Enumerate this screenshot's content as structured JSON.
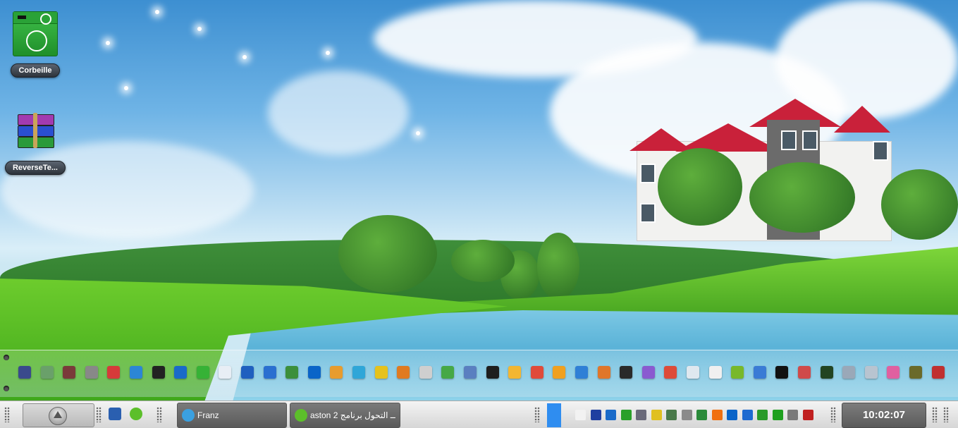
{
  "desktop": {
    "icons": [
      {
        "label": "Corbeille",
        "icon": "recycle-bin-icon"
      },
      {
        "label": "ReverseTe...",
        "icon": "winrar-archive-icon"
      }
    ]
  },
  "dock": {
    "items": [
      {
        "icon": "app-icon",
        "color": "#3a4a8c"
      },
      {
        "icon": "recycle-bin-icon",
        "color": "#6aa06a"
      },
      {
        "icon": "trash-icon",
        "color": "#7a3a3a"
      },
      {
        "icon": "pin-icon",
        "color": "#888888"
      },
      {
        "icon": "lifebuoy-icon",
        "color": "#d63a3a"
      },
      {
        "icon": "globe-icon",
        "color": "#2c86d6"
      },
      {
        "icon": "terminal-icon",
        "color": "#222222"
      },
      {
        "icon": "wifi-icon",
        "color": "#1a6ac9"
      },
      {
        "icon": "wireless-icon",
        "color": "#36b236"
      },
      {
        "icon": "document-icon",
        "color": "#e8eef5"
      },
      {
        "icon": "cursor-icon",
        "color": "#1f5fbf"
      },
      {
        "icon": "map-icon",
        "color": "#2a6fd0"
      },
      {
        "icon": "monitor-icon",
        "color": "#3c8f3c"
      },
      {
        "icon": "teamviewer-icon",
        "color": "#0a64c8"
      },
      {
        "icon": "folder-icon",
        "color": "#e89c2e"
      },
      {
        "icon": "kodi-icon",
        "color": "#2fa6d8"
      },
      {
        "icon": "notes-icon",
        "color": "#e6c21c"
      },
      {
        "icon": "box-icon",
        "color": "#e07a20"
      },
      {
        "icon": "clock-icon",
        "color": "#cfcfcf"
      },
      {
        "icon": "check-icon",
        "color": "#46a846"
      },
      {
        "icon": "shield-icon",
        "color": "#5a7fc0"
      },
      {
        "icon": "cpu-meter-icon",
        "color": "#1e1e1e"
      },
      {
        "icon": "weather-icon",
        "color": "#f2b632"
      },
      {
        "icon": "chrome-colored-icon",
        "color": "#e04a3a"
      },
      {
        "icon": "settings-icon",
        "color": "#f0a020"
      },
      {
        "icon": "ol-icon",
        "color": "#2f7fd6"
      },
      {
        "icon": "photo-icon",
        "color": "#e0762a"
      },
      {
        "icon": "disk-meter-icon",
        "color": "#2a2a2a"
      },
      {
        "icon": "orb-icon",
        "color": "#8a5ad0"
      },
      {
        "icon": "chrome-icon",
        "color": "#dd4b39"
      },
      {
        "icon": "ring-icon",
        "color": "#dfe8ef"
      },
      {
        "icon": "edit-icon",
        "color": "#f0f0f0"
      },
      {
        "icon": "recycle-icon",
        "color": "#78b82a"
      },
      {
        "icon": "windows-icon",
        "color": "#3a7bd5"
      },
      {
        "icon": "grid-icon",
        "color": "#111111"
      },
      {
        "icon": "tools-icon",
        "color": "#d04a4a"
      },
      {
        "icon": "screen-icon",
        "color": "#224422"
      },
      {
        "icon": "network-icon",
        "color": "#9aa8b8"
      },
      {
        "icon": "printer-icon",
        "color": "#b8c4d0"
      },
      {
        "icon": "flower-icon",
        "color": "#e060a0"
      },
      {
        "icon": "book-icon",
        "color": "#6a6a2a"
      },
      {
        "icon": "flag-icon",
        "color": "#c03030"
      }
    ]
  },
  "taskbar": {
    "quick_launch": [
      {
        "icon": "show-desktop-icon",
        "color": "#2a5fb0"
      },
      {
        "icon": "aston-icon",
        "color": "#5cbf2a"
      }
    ],
    "tasks": [
      {
        "title": "Franz",
        "icon": "franz-icon",
        "color": "#3aa0e0"
      },
      {
        "title": "aston 2 ــ التحول برنامج",
        "icon": "aston-icon",
        "color": "#5cbf2a"
      }
    ],
    "tray": [
      {
        "icon": "sheep-icon",
        "color": "#f2f2f2"
      },
      {
        "icon": "window-icon",
        "color": "#1f3fa0"
      },
      {
        "icon": "wifi-icon",
        "color": "#1a6ac9"
      },
      {
        "icon": "r-icon",
        "color": "#2aa02a"
      },
      {
        "icon": "diamond-icon",
        "color": "#6a6a7a"
      },
      {
        "icon": "eyes-icon",
        "color": "#e0c020"
      },
      {
        "icon": "usb-icon",
        "color": "#4a7a4a"
      },
      {
        "icon": "battery-icon",
        "color": "#8a8a8a"
      },
      {
        "icon": "globe-icon",
        "color": "#2a8a3a"
      },
      {
        "icon": "avast-icon",
        "color": "#f07010"
      },
      {
        "icon": "teamviewer-icon",
        "color": "#0a64c8"
      },
      {
        "icon": "app-grid-icon",
        "color": "#1e6ad0"
      },
      {
        "icon": "clock-icon",
        "color": "#2a9a2a"
      },
      {
        "icon": "flag-icon",
        "color": "#1fa01f"
      },
      {
        "icon": "signal-icon",
        "color": "#7a7a7a"
      },
      {
        "icon": "speaker-icon",
        "color": "#c02020"
      }
    ],
    "clock": "10:02:07"
  }
}
